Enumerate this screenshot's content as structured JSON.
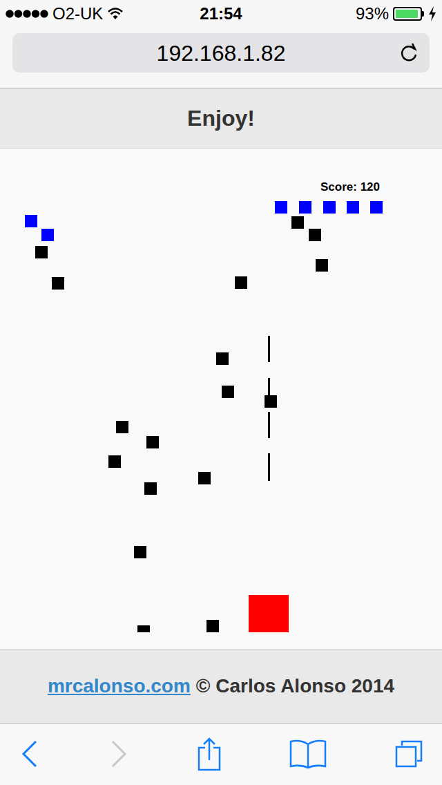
{
  "status_bar": {
    "carrier": "O2-UK",
    "time": "21:54",
    "battery_text": "93%",
    "signal": {
      "level": 1
    },
    "battery": {
      "level": 0.93,
      "charging": true
    }
  },
  "address_bar": {
    "url": "192.168.1.82"
  },
  "header": {
    "title": "Enjoy!"
  },
  "game": {
    "score": "Score: 120",
    "squares": [
      {
        "color": "#0000ff"
      },
      {
        "color": "#0000ff"
      },
      {
        "color": "#0000ff"
      },
      {
        "color": "#0000ff"
      },
      {
        "color": "#0000ff"
      },
      {
        "color": "#0000ff"
      },
      {
        "color": "#0000ff"
      },
      {
        "color": "#000000"
      },
      {
        "color": "#000000"
      },
      {
        "color": "#000000"
      },
      {
        "color": "#000000"
      },
      {
        "color": "#000000"
      },
      {
        "color": "#000000"
      },
      {
        "color": "#000000"
      },
      {
        "color": "#000000"
      },
      {
        "color": "#000000"
      },
      {
        "color": "#000000"
      },
      {
        "color": "#000000"
      },
      {
        "color": "#000000"
      },
      {
        "color": "#000000"
      },
      {
        "color": "#000000"
      },
      {
        "color": "#000000"
      },
      {
        "color": "#000000"
      },
      {
        "color": "#000000"
      }
    ]
  },
  "footer": {
    "link": "mrcalonso.com",
    "text": "© Carlos Alonso 2014"
  },
  "toolbar": {
    "back": {
      "disabled": false
    },
    "forward": {
      "disabled": true
    }
  }
}
